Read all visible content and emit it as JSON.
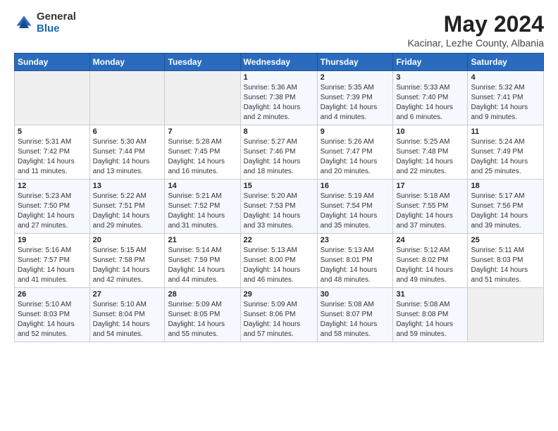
{
  "logo": {
    "general": "General",
    "blue": "Blue"
  },
  "title": "May 2024",
  "subtitle": "Kacinar, Lezhe County, Albania",
  "days_of_week": [
    "Sunday",
    "Monday",
    "Tuesday",
    "Wednesday",
    "Thursday",
    "Friday",
    "Saturday"
  ],
  "weeks": [
    [
      {
        "day": "",
        "info": ""
      },
      {
        "day": "",
        "info": ""
      },
      {
        "day": "",
        "info": ""
      },
      {
        "day": "1",
        "info": "Sunrise: 5:36 AM\nSunset: 7:38 PM\nDaylight: 14 hours\nand 2 minutes."
      },
      {
        "day": "2",
        "info": "Sunrise: 5:35 AM\nSunset: 7:39 PM\nDaylight: 14 hours\nand 4 minutes."
      },
      {
        "day": "3",
        "info": "Sunrise: 5:33 AM\nSunset: 7:40 PM\nDaylight: 14 hours\nand 6 minutes."
      },
      {
        "day": "4",
        "info": "Sunrise: 5:32 AM\nSunset: 7:41 PM\nDaylight: 14 hours\nand 9 minutes."
      }
    ],
    [
      {
        "day": "5",
        "info": "Sunrise: 5:31 AM\nSunset: 7:42 PM\nDaylight: 14 hours\nand 11 minutes."
      },
      {
        "day": "6",
        "info": "Sunrise: 5:30 AM\nSunset: 7:44 PM\nDaylight: 14 hours\nand 13 minutes."
      },
      {
        "day": "7",
        "info": "Sunrise: 5:28 AM\nSunset: 7:45 PM\nDaylight: 14 hours\nand 16 minutes."
      },
      {
        "day": "8",
        "info": "Sunrise: 5:27 AM\nSunset: 7:46 PM\nDaylight: 14 hours\nand 18 minutes."
      },
      {
        "day": "9",
        "info": "Sunrise: 5:26 AM\nSunset: 7:47 PM\nDaylight: 14 hours\nand 20 minutes."
      },
      {
        "day": "10",
        "info": "Sunrise: 5:25 AM\nSunset: 7:48 PM\nDaylight: 14 hours\nand 22 minutes."
      },
      {
        "day": "11",
        "info": "Sunrise: 5:24 AM\nSunset: 7:49 PM\nDaylight: 14 hours\nand 25 minutes."
      }
    ],
    [
      {
        "day": "12",
        "info": "Sunrise: 5:23 AM\nSunset: 7:50 PM\nDaylight: 14 hours\nand 27 minutes."
      },
      {
        "day": "13",
        "info": "Sunrise: 5:22 AM\nSunset: 7:51 PM\nDaylight: 14 hours\nand 29 minutes."
      },
      {
        "day": "14",
        "info": "Sunrise: 5:21 AM\nSunset: 7:52 PM\nDaylight: 14 hours\nand 31 minutes."
      },
      {
        "day": "15",
        "info": "Sunrise: 5:20 AM\nSunset: 7:53 PM\nDaylight: 14 hours\nand 33 minutes."
      },
      {
        "day": "16",
        "info": "Sunrise: 5:19 AM\nSunset: 7:54 PM\nDaylight: 14 hours\nand 35 minutes."
      },
      {
        "day": "17",
        "info": "Sunrise: 5:18 AM\nSunset: 7:55 PM\nDaylight: 14 hours\nand 37 minutes."
      },
      {
        "day": "18",
        "info": "Sunrise: 5:17 AM\nSunset: 7:56 PM\nDaylight: 14 hours\nand 39 minutes."
      }
    ],
    [
      {
        "day": "19",
        "info": "Sunrise: 5:16 AM\nSunset: 7:57 PM\nDaylight: 14 hours\nand 41 minutes."
      },
      {
        "day": "20",
        "info": "Sunrise: 5:15 AM\nSunset: 7:58 PM\nDaylight: 14 hours\nand 42 minutes."
      },
      {
        "day": "21",
        "info": "Sunrise: 5:14 AM\nSunset: 7:59 PM\nDaylight: 14 hours\nand 44 minutes."
      },
      {
        "day": "22",
        "info": "Sunrise: 5:13 AM\nSunset: 8:00 PM\nDaylight: 14 hours\nand 46 minutes."
      },
      {
        "day": "23",
        "info": "Sunrise: 5:13 AM\nSunset: 8:01 PM\nDaylight: 14 hours\nand 48 minutes."
      },
      {
        "day": "24",
        "info": "Sunrise: 5:12 AM\nSunset: 8:02 PM\nDaylight: 14 hours\nand 49 minutes."
      },
      {
        "day": "25",
        "info": "Sunrise: 5:11 AM\nSunset: 8:03 PM\nDaylight: 14 hours\nand 51 minutes."
      }
    ],
    [
      {
        "day": "26",
        "info": "Sunrise: 5:10 AM\nSunset: 8:03 PM\nDaylight: 14 hours\nand 52 minutes."
      },
      {
        "day": "27",
        "info": "Sunrise: 5:10 AM\nSunset: 8:04 PM\nDaylight: 14 hours\nand 54 minutes."
      },
      {
        "day": "28",
        "info": "Sunrise: 5:09 AM\nSunset: 8:05 PM\nDaylight: 14 hours\nand 55 minutes."
      },
      {
        "day": "29",
        "info": "Sunrise: 5:09 AM\nSunset: 8:06 PM\nDaylight: 14 hours\nand 57 minutes."
      },
      {
        "day": "30",
        "info": "Sunrise: 5:08 AM\nSunset: 8:07 PM\nDaylight: 14 hours\nand 58 minutes."
      },
      {
        "day": "31",
        "info": "Sunrise: 5:08 AM\nSunset: 8:08 PM\nDaylight: 14 hours\nand 59 minutes."
      },
      {
        "day": "",
        "info": ""
      }
    ]
  ]
}
